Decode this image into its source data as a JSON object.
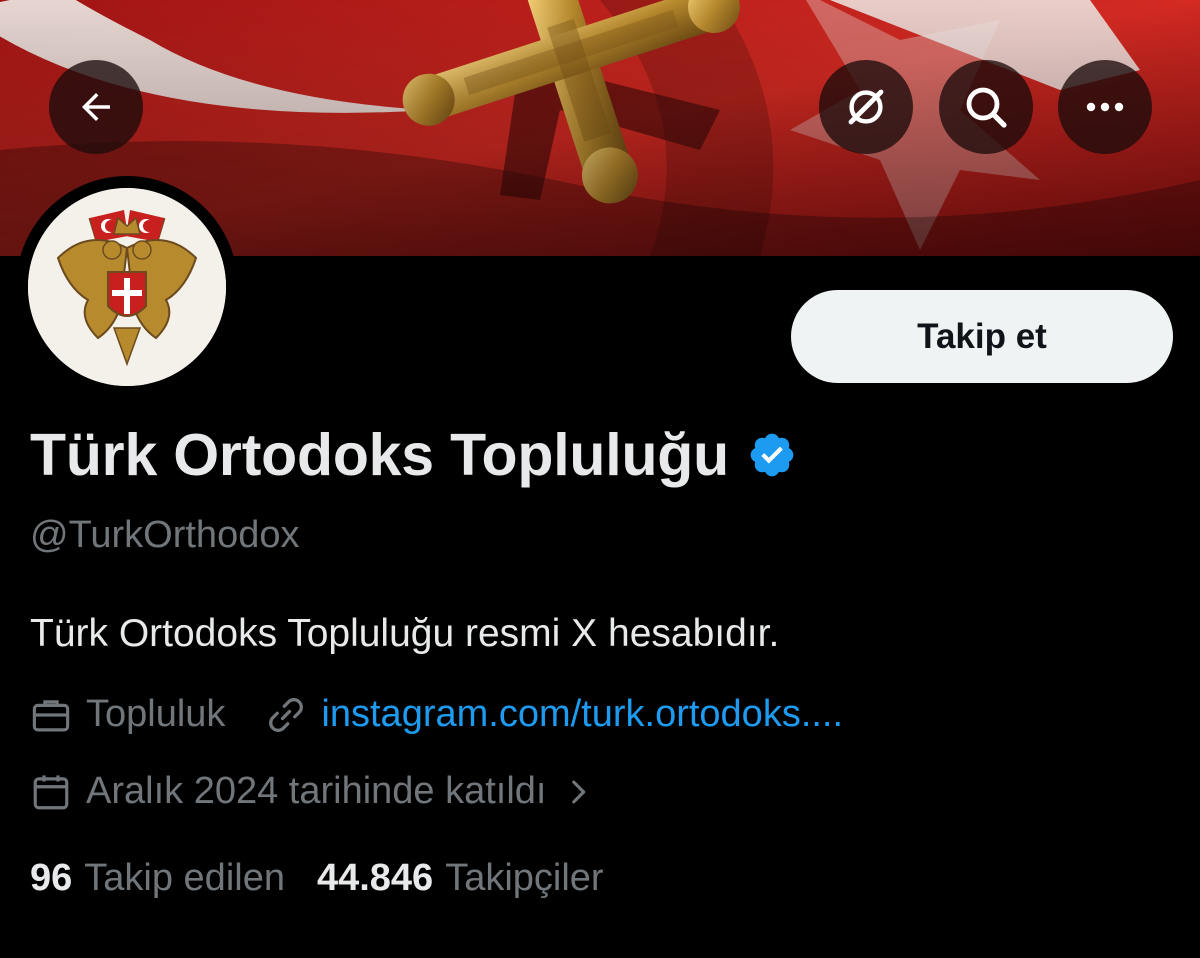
{
  "header": {
    "back_icon": "arrow-left-icon",
    "grok_icon": "grok-icon",
    "search_icon": "search-icon",
    "more_icon": "more-horizontal-icon"
  },
  "profile": {
    "display_name": "Türk Ortodoks Topluluğu",
    "verified": true,
    "handle": "@TurkOrthodox",
    "bio": "Türk Ortodoks Topluluğu resmi X hesabıdır.",
    "category": "Topluluk",
    "link_text": "instagram.com/turk.ortodoks....",
    "joined": "Aralık 2024 tarihinde katıldı",
    "follow_button": "Takip et",
    "following_count": "96",
    "following_label": "Takip edilen",
    "followers_count": "44.846",
    "followers_label": "Takipçiler"
  },
  "colors": {
    "background": "#000000",
    "primary_text": "#e7e9ea",
    "secondary_text": "#71767b",
    "link": "#1d9bf0",
    "verified_badge": "#1d9bf0",
    "banner_red": "#c8201e",
    "follow_button_bg": "#eff3f4"
  }
}
